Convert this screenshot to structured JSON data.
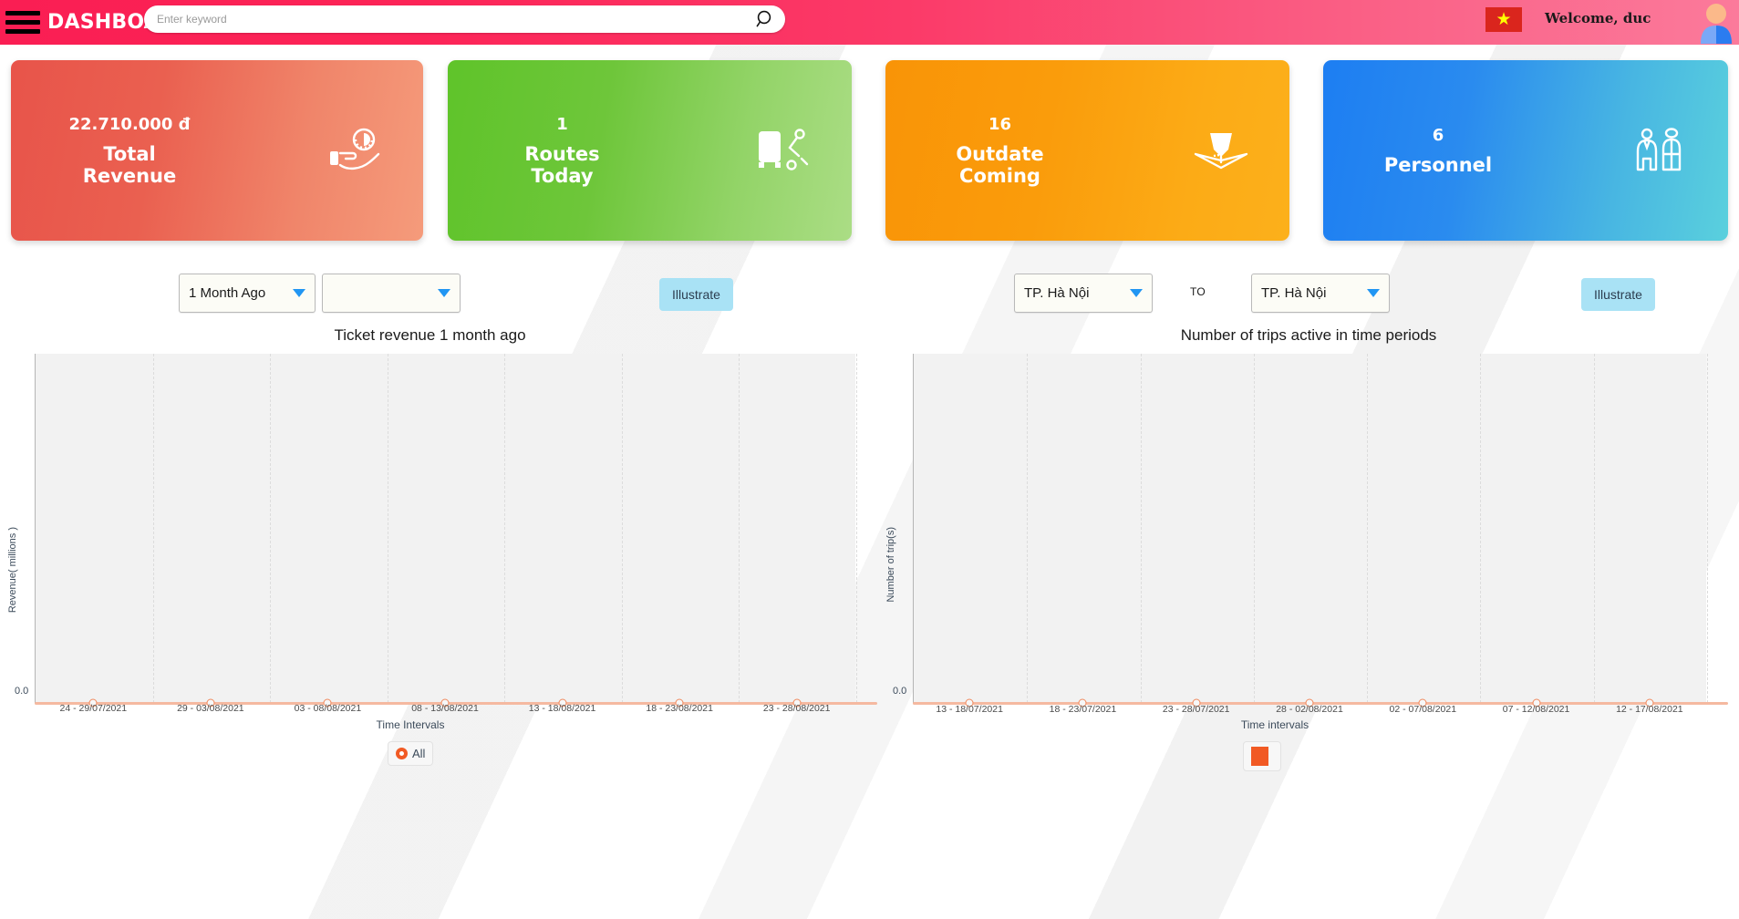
{
  "header": {
    "menu_icon": "hamburger-icon",
    "brand": "DASHBOARD",
    "search_placeholder": "Enter keyword",
    "search_value": "",
    "search_icon": "search-icon",
    "flag_icon": "vietnam-flag-icon",
    "flag_star": "★",
    "welcome": "Welcome, duc",
    "avatar_icon": "user-avatar-icon",
    "bg_accent": "#fa1e53"
  },
  "cards": [
    {
      "value": "22.710.000 đ",
      "label": "Total Revenue",
      "icon": "hand-coin-icon",
      "color": "#e8544a"
    },
    {
      "value": "1",
      "label": "Routes Today",
      "icon": "bus-route-icon",
      "color": "#5fc42a"
    },
    {
      "value": "16",
      "label": "Outdate Coming",
      "icon": "expiring-map-icon",
      "color": "#f99407"
    },
    {
      "value": "6",
      "label": "Personnel",
      "icon": "two-people-icon",
      "color": "#1d7ef2"
    }
  ],
  "controls_left": {
    "period_select": "1 Month Ago",
    "blank_select": "",
    "illustrate_label": "Illustrate",
    "caret_icon": "chevron-down-icon",
    "accent": "#a9e2f5"
  },
  "controls_right": {
    "from_select": "TP. Hà Nội",
    "to_label": "TO",
    "to_select": "TP. Hà Nội",
    "illustrate_label": "Illustrate",
    "caret_icon": "chevron-down-icon"
  },
  "chart_data": [
    {
      "type": "line",
      "title": "Ticket revenue 1 month ago",
      "xlabel": "Time Intervals",
      "ylabel": "Revenue( millions )",
      "categories": [
        "24 - 29/07/2021",
        "29 - 03/08/2021",
        "03 - 08/08/2021",
        "08 - 13/08/2021",
        "13 - 18/08/2021",
        "18 - 23/08/2021",
        "23 - 28/08/2021"
      ],
      "series": [
        {
          "name": "All",
          "values": [
            0,
            0,
            0,
            0,
            0,
            0,
            0
          ],
          "color": "#f15a24"
        }
      ],
      "ytick_labels": [
        "0.0"
      ],
      "ylim": [
        0,
        1
      ],
      "grid": true,
      "legend_position": "bottom",
      "legend_marker": "ring"
    },
    {
      "type": "line",
      "title": "Number of trips active in time periods",
      "xlabel": "Time intervals",
      "ylabel": "Number of trip(s)",
      "categories": [
        "13 - 18/07/2021",
        "18 - 23/07/2021",
        "23 - 28/07/2021",
        "28 - 02/08/2021",
        "02 - 07/08/2021",
        "07 - 12/08/2021",
        "12 - 17/08/2021"
      ],
      "series": [
        {
          "name": "",
          "values": [
            0,
            0,
            0,
            0,
            0,
            0,
            0
          ],
          "color": "#f15a24"
        }
      ],
      "ytick_labels": [
        "0.0"
      ],
      "ylim": [
        0,
        1
      ],
      "grid": true,
      "legend_position": "bottom",
      "legend_marker": "square"
    }
  ]
}
